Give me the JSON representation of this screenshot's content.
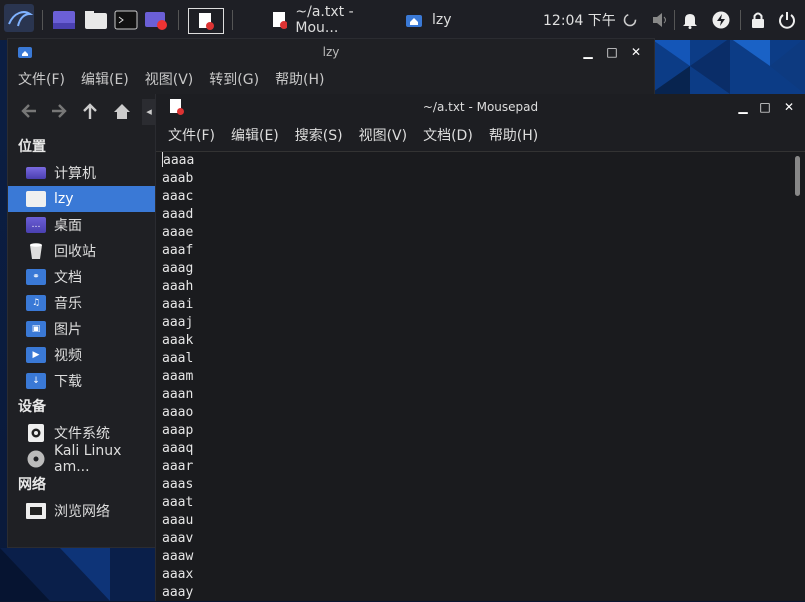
{
  "panel": {
    "tasks": [
      {
        "label": "~/a.txt - Mou...",
        "icon": "mousepad-icon"
      },
      {
        "label": "lzy",
        "icon": "folder-home-icon"
      }
    ],
    "clock": "12:04 下午"
  },
  "file_manager": {
    "title": "lzy",
    "menu": [
      "文件(F)",
      "编辑(E)",
      "视图(V)",
      "转到(G)",
      "帮助(H)"
    ],
    "sections": [
      {
        "heading": "位置",
        "items": [
          {
            "label": "计算机",
            "icon": "computer-icon",
            "active": false
          },
          {
            "label": "lzy",
            "icon": "home-folder-icon",
            "active": true
          },
          {
            "label": "桌面",
            "icon": "desktop-folder-icon",
            "active": false
          },
          {
            "label": "回收站",
            "icon": "trash-icon",
            "active": false
          },
          {
            "label": "文档",
            "icon": "documents-folder-icon",
            "active": false
          },
          {
            "label": "音乐",
            "icon": "music-folder-icon",
            "active": false
          },
          {
            "label": "图片",
            "icon": "pictures-folder-icon",
            "active": false
          },
          {
            "label": "视频",
            "icon": "videos-folder-icon",
            "active": false
          },
          {
            "label": "下载",
            "icon": "downloads-folder-icon",
            "active": false
          }
        ]
      },
      {
        "heading": "设备",
        "items": [
          {
            "label": "文件系统",
            "icon": "drive-icon",
            "active": false
          },
          {
            "label": "Kali Linux am...",
            "icon": "disc-icon",
            "active": false
          }
        ]
      },
      {
        "heading": "网络",
        "items": [
          {
            "label": "浏览网络",
            "icon": "network-icon",
            "active": false
          }
        ]
      }
    ]
  },
  "mousepad": {
    "title": "~/a.txt - Mousepad",
    "menu": [
      "文件(F)",
      "编辑(E)",
      "搜索(S)",
      "视图(V)",
      "文档(D)",
      "帮助(H)"
    ],
    "lines": [
      "aaaa",
      "aaab",
      "aaac",
      "aaad",
      "aaae",
      "aaaf",
      "aaag",
      "aaah",
      "aaai",
      "aaaj",
      "aaak",
      "aaal",
      "aaam",
      "aaan",
      "aaao",
      "aaap",
      "aaaq",
      "aaar",
      "aaas",
      "aaat",
      "aaau",
      "aaav",
      "aaaw",
      "aaax",
      "aaay"
    ]
  },
  "colors": {
    "accent": "#3a79d6",
    "panel": "#1e1f25"
  }
}
